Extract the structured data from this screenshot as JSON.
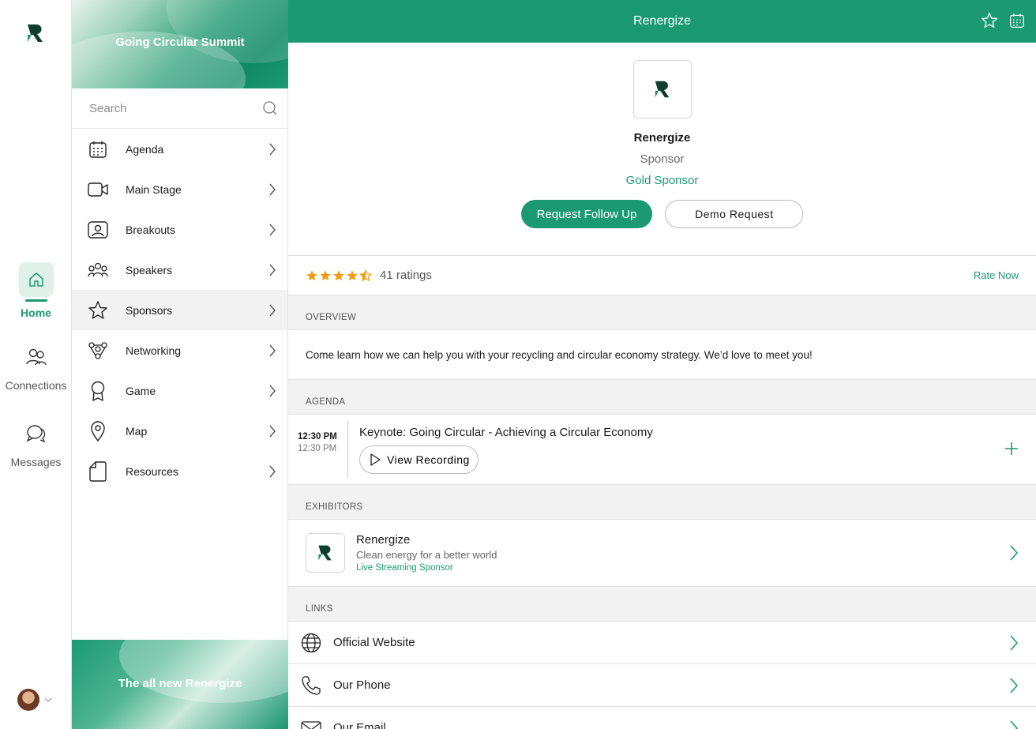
{
  "colors": {
    "accent": "#1b9a72",
    "star": "#f39c12"
  },
  "rail": {
    "items": [
      {
        "label": "Home",
        "icon": "home-icon",
        "active": true
      },
      {
        "label": "Connections",
        "icon": "people-icon"
      },
      {
        "label": "Messages",
        "icon": "chat-icon"
      }
    ]
  },
  "sidebar": {
    "banner_title": "Going Circular Summit",
    "search_placeholder": "Search",
    "items": [
      {
        "label": "Agenda",
        "icon": "calendar-icon"
      },
      {
        "label": "Main Stage",
        "icon": "video-icon"
      },
      {
        "label": "Breakouts",
        "icon": "breakout-icon"
      },
      {
        "label": "Speakers",
        "icon": "speakers-icon"
      },
      {
        "label": "Sponsors",
        "icon": "star-icon",
        "active": true
      },
      {
        "label": "Networking",
        "icon": "networking-icon"
      },
      {
        "label": "Game",
        "icon": "award-icon"
      },
      {
        "label": "Map",
        "icon": "map-pin-icon"
      },
      {
        "label": "Resources",
        "icon": "document-icon"
      }
    ],
    "promo_title": "The all new Renergize"
  },
  "header": {
    "title": "Renergize"
  },
  "sponsor": {
    "name": "Renergize",
    "type": "Sponsor",
    "tier": "Gold Sponsor",
    "primary_button": "Request Follow Up",
    "secondary_button": "Demo Request"
  },
  "ratings": {
    "stars": 4.5,
    "count_text": "41 ratings",
    "rate_now": "Rate Now"
  },
  "overview": {
    "heading": "OVERVIEW",
    "text": "Come learn how we can help you with your recycling and circular economy strategy. We’d love to meet you!"
  },
  "agenda": {
    "heading": "AGENDA",
    "start": "12:30 PM",
    "end": "12:30 PM",
    "title": "Keynote: Going Circular - Achieving a Circular Economy",
    "button": "View Recording"
  },
  "exhibitors": {
    "heading": "EXHIBITORS",
    "name": "Renergize",
    "tagline": "Clean energy for a better world",
    "tier": "Live Streaming Sponsor"
  },
  "links": {
    "heading": "LINKS",
    "items": [
      {
        "label": "Official Website",
        "icon": "globe-icon"
      },
      {
        "label": "Our Phone",
        "icon": "phone-icon"
      },
      {
        "label": "Our Email",
        "icon": "mail-icon"
      }
    ]
  }
}
